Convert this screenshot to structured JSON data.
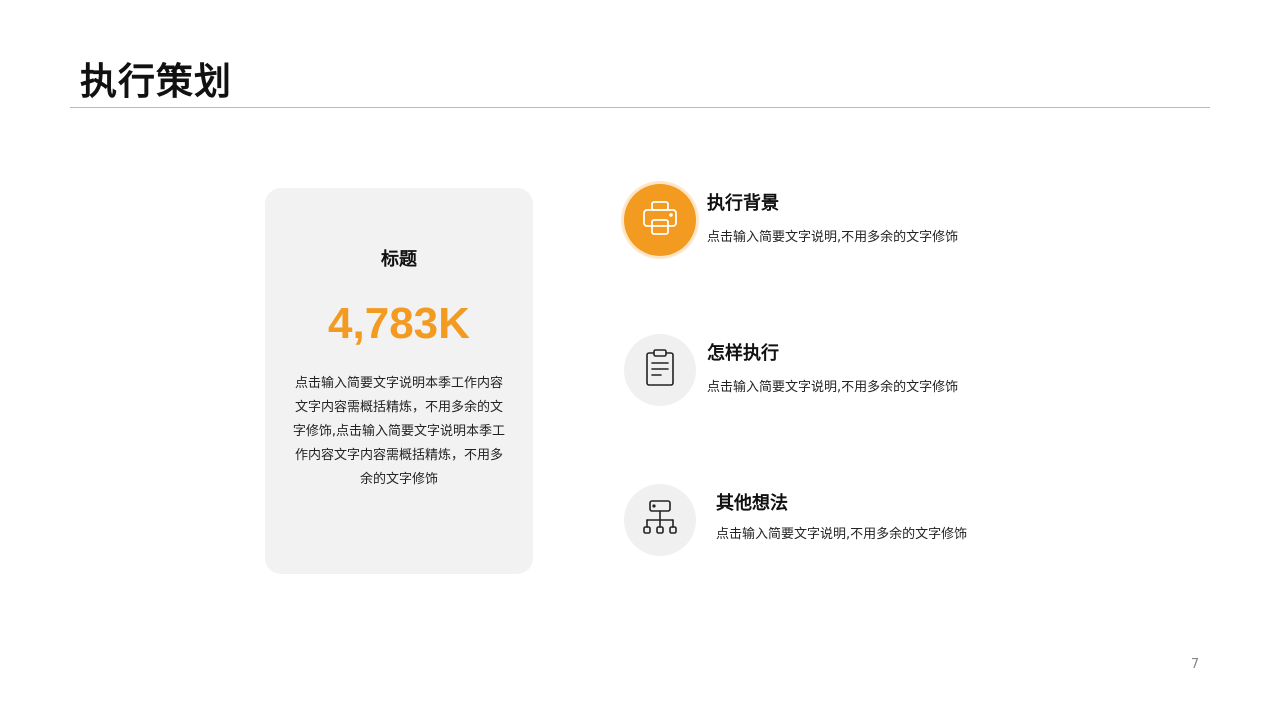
{
  "slide": {
    "title": "执行策划",
    "page_number": "7"
  },
  "card": {
    "title": "标题",
    "value": "4,783K",
    "description": "点击输入简要文字说明本季工作内容文字内容需概括精炼，不用多余的文字修饰,点击输入简要文字说明本季工作内容文字内容需概括精炼，不用多余的文字修饰"
  },
  "items": [
    {
      "icon": "printer-icon",
      "title": "执行背景",
      "description": "点击输入简要文字说明,不用多余的文字修饰"
    },
    {
      "icon": "clipboard-icon",
      "title": "怎样执行",
      "description": "点击输入简要文字说明,不用多余的文字修饰"
    },
    {
      "icon": "hierarchy-icon",
      "title": "其他想法",
      "description": "点击输入简要文字说明,不用多余的文字修饰"
    }
  ],
  "colors": {
    "accent": "#f39a21",
    "accent_ring": "#fde6c8",
    "card_background": "#f2f2f2",
    "icon_background": "#f0f0f0",
    "rule": "#b8b8b8"
  }
}
